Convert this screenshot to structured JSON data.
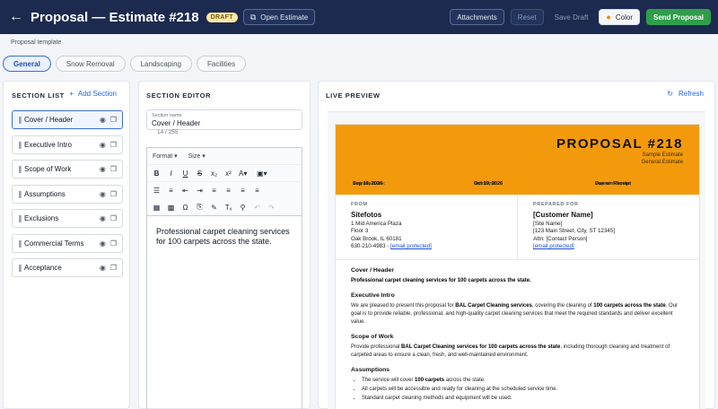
{
  "header": {
    "title": "Proposal — Estimate #218",
    "badge": "DRAFT",
    "open_estimate": "Open Estimate",
    "attachments": "Attachments",
    "reset": "Reset",
    "save_draft": "Save Draft",
    "color": "Color",
    "send": "Send Proposal",
    "accent_color": "#2f9e4a",
    "bar_color": "#1b2a4e"
  },
  "template_label": "Proposal template",
  "tabs": [
    "General",
    "Snow Removal",
    "Landscaping",
    "Facilities"
  ],
  "section_list": {
    "heading": "SECTION LIST",
    "add_label": "Add Section",
    "items": [
      "Cover / Header",
      "Executive Intro",
      "Scope of Work",
      "Assumptions",
      "Exclusions",
      "Commercial Terms",
      "Acceptance"
    ]
  },
  "section_editor": {
    "heading": "SECTION EDITOR",
    "field_label": "Section name",
    "field_value": "Cover / Header",
    "char_count": "14 / 255",
    "format_select": "Format",
    "size_select": "Size",
    "body": "Professional carpet cleaning services for 100 carpets across the state."
  },
  "preview": {
    "heading": "LIVE PREVIEW",
    "refresh": "Refresh",
    "banner_color": "#f39a0c",
    "title": "PROPOSAL #218",
    "subtitle1": "Sample Estimate",
    "subtitle2": "General Estimate",
    "date_label": "Proposal Date:",
    "date_value": "Sep 19, 2026",
    "valid_label": "Valid Until:",
    "valid_value": "Oct 19, 2026",
    "terms_label": "Payment Terms:",
    "terms_value": "Due on Receipt",
    "from_cap": "FROM",
    "from_name": "Sitefotos",
    "from_addr1": "1 Mid America Plaza",
    "from_addr2": "Floor 3",
    "from_addr3": "Oak Brook, IL 60181",
    "from_phone": "630-210-4983 ·",
    "from_email": "[email protected]",
    "to_cap": "PREPARED FOR",
    "to_name": "[Customer Name]",
    "to_site": "[Site Name]",
    "to_addr": "[123 Main Street, City, ST 12345]",
    "to_attn": "Attn: [Contact Person]",
    "to_email": "[email protected]",
    "s1_title": "Cover / Header",
    "s1_body": "Professional carpet cleaning services for 100 carpets across the state.",
    "s2_title": "Executive Intro",
    "s2_a": "We are pleased to present this proposal for",
    "s2_b": "BAL Carpet Cleaning services",
    "s2_c": ", covering the cleaning of",
    "s2_d": "100 carpets across the state",
    "s2_e": ". Our goal is to provide reliable, professional, and high-quality carpet cleaning services that meet the required standards and deliver excellent value.",
    "s3_title": "Scope of Work",
    "s3_a": "Provide professional",
    "s3_b": "BAL Carpet Cleaning services for 100 carpets across the state",
    "s3_c": ", including thorough cleaning and treatment of carpeted areas to ensure a clean, fresh, and well-maintained environment.",
    "s4_title": "Assumptions",
    "s4_li1_a": "The service will cover",
    "s4_li1_b": "100 carpets",
    "s4_li1_c": "across the state.",
    "s4_li2": "All carpets will be accessible and ready for cleaning at the scheduled service time.",
    "s4_li3": "Standard carpet cleaning methods and equipment will be used."
  }
}
